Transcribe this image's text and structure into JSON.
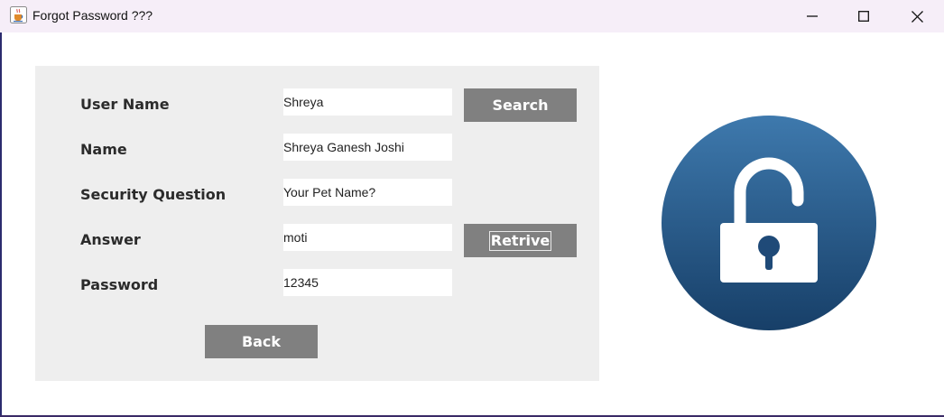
{
  "window": {
    "title": "Forgot Password ???",
    "icon": "java-cup-icon",
    "controls": [
      "minimize-icon",
      "maximize-icon",
      "close-icon"
    ]
  },
  "form": {
    "fields": [
      {
        "label": "User Name",
        "value": "Shreya"
      },
      {
        "label": "Name",
        "value": "Shreya Ganesh Joshi"
      },
      {
        "label": "Security Question",
        "value": "Your Pet Name?"
      },
      {
        "label": "Answer",
        "value": "moti"
      },
      {
        "label": "Password",
        "value": "12345"
      }
    ],
    "buttons": {
      "search": "Search",
      "retrive": "Retrive",
      "back": "Back"
    }
  },
  "image": {
    "icon": "unlocked-padlock-icon",
    "colors": {
      "circle_top": "#3e79ad",
      "circle_bottom": "#173f68",
      "lock": "#ffffff"
    }
  },
  "colors": {
    "panel": "#eeeeee",
    "button": "#808080",
    "titlebar": "#f6eef8"
  }
}
